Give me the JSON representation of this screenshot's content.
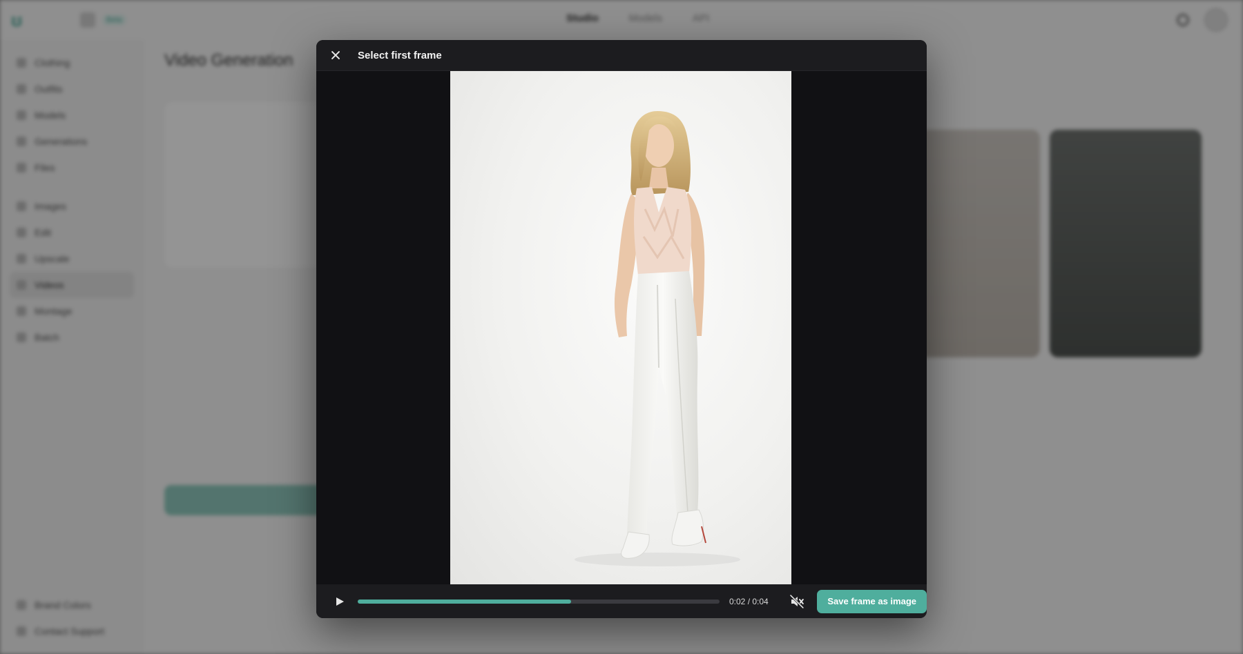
{
  "app": {
    "workspace_badge": "Beta",
    "nav": [
      "Studio",
      "Models",
      "API"
    ],
    "page_title": "Video Generation",
    "sidebar_items": [
      "Clothing",
      "Outfits",
      "Models",
      "Generations",
      "Files",
      "Images",
      "Edit",
      "Upscale",
      "Videos",
      "Montage",
      "Batch"
    ],
    "sidebar_active": "Videos",
    "sidebar_bottom": [
      "Brand Colors",
      "Contact Support"
    ]
  },
  "modal": {
    "title": "Select first frame",
    "time": "0:02 / 0:04",
    "progress_fraction": 0.59,
    "save_label": "Save frame as image"
  },
  "colors": {
    "accent": "#4fae9d",
    "modal_bg": "#141416",
    "header_bg": "#1c1c1f"
  },
  "icons": {
    "close": "close-icon",
    "play": "play-icon",
    "mute": "muted-speaker-icon"
  }
}
